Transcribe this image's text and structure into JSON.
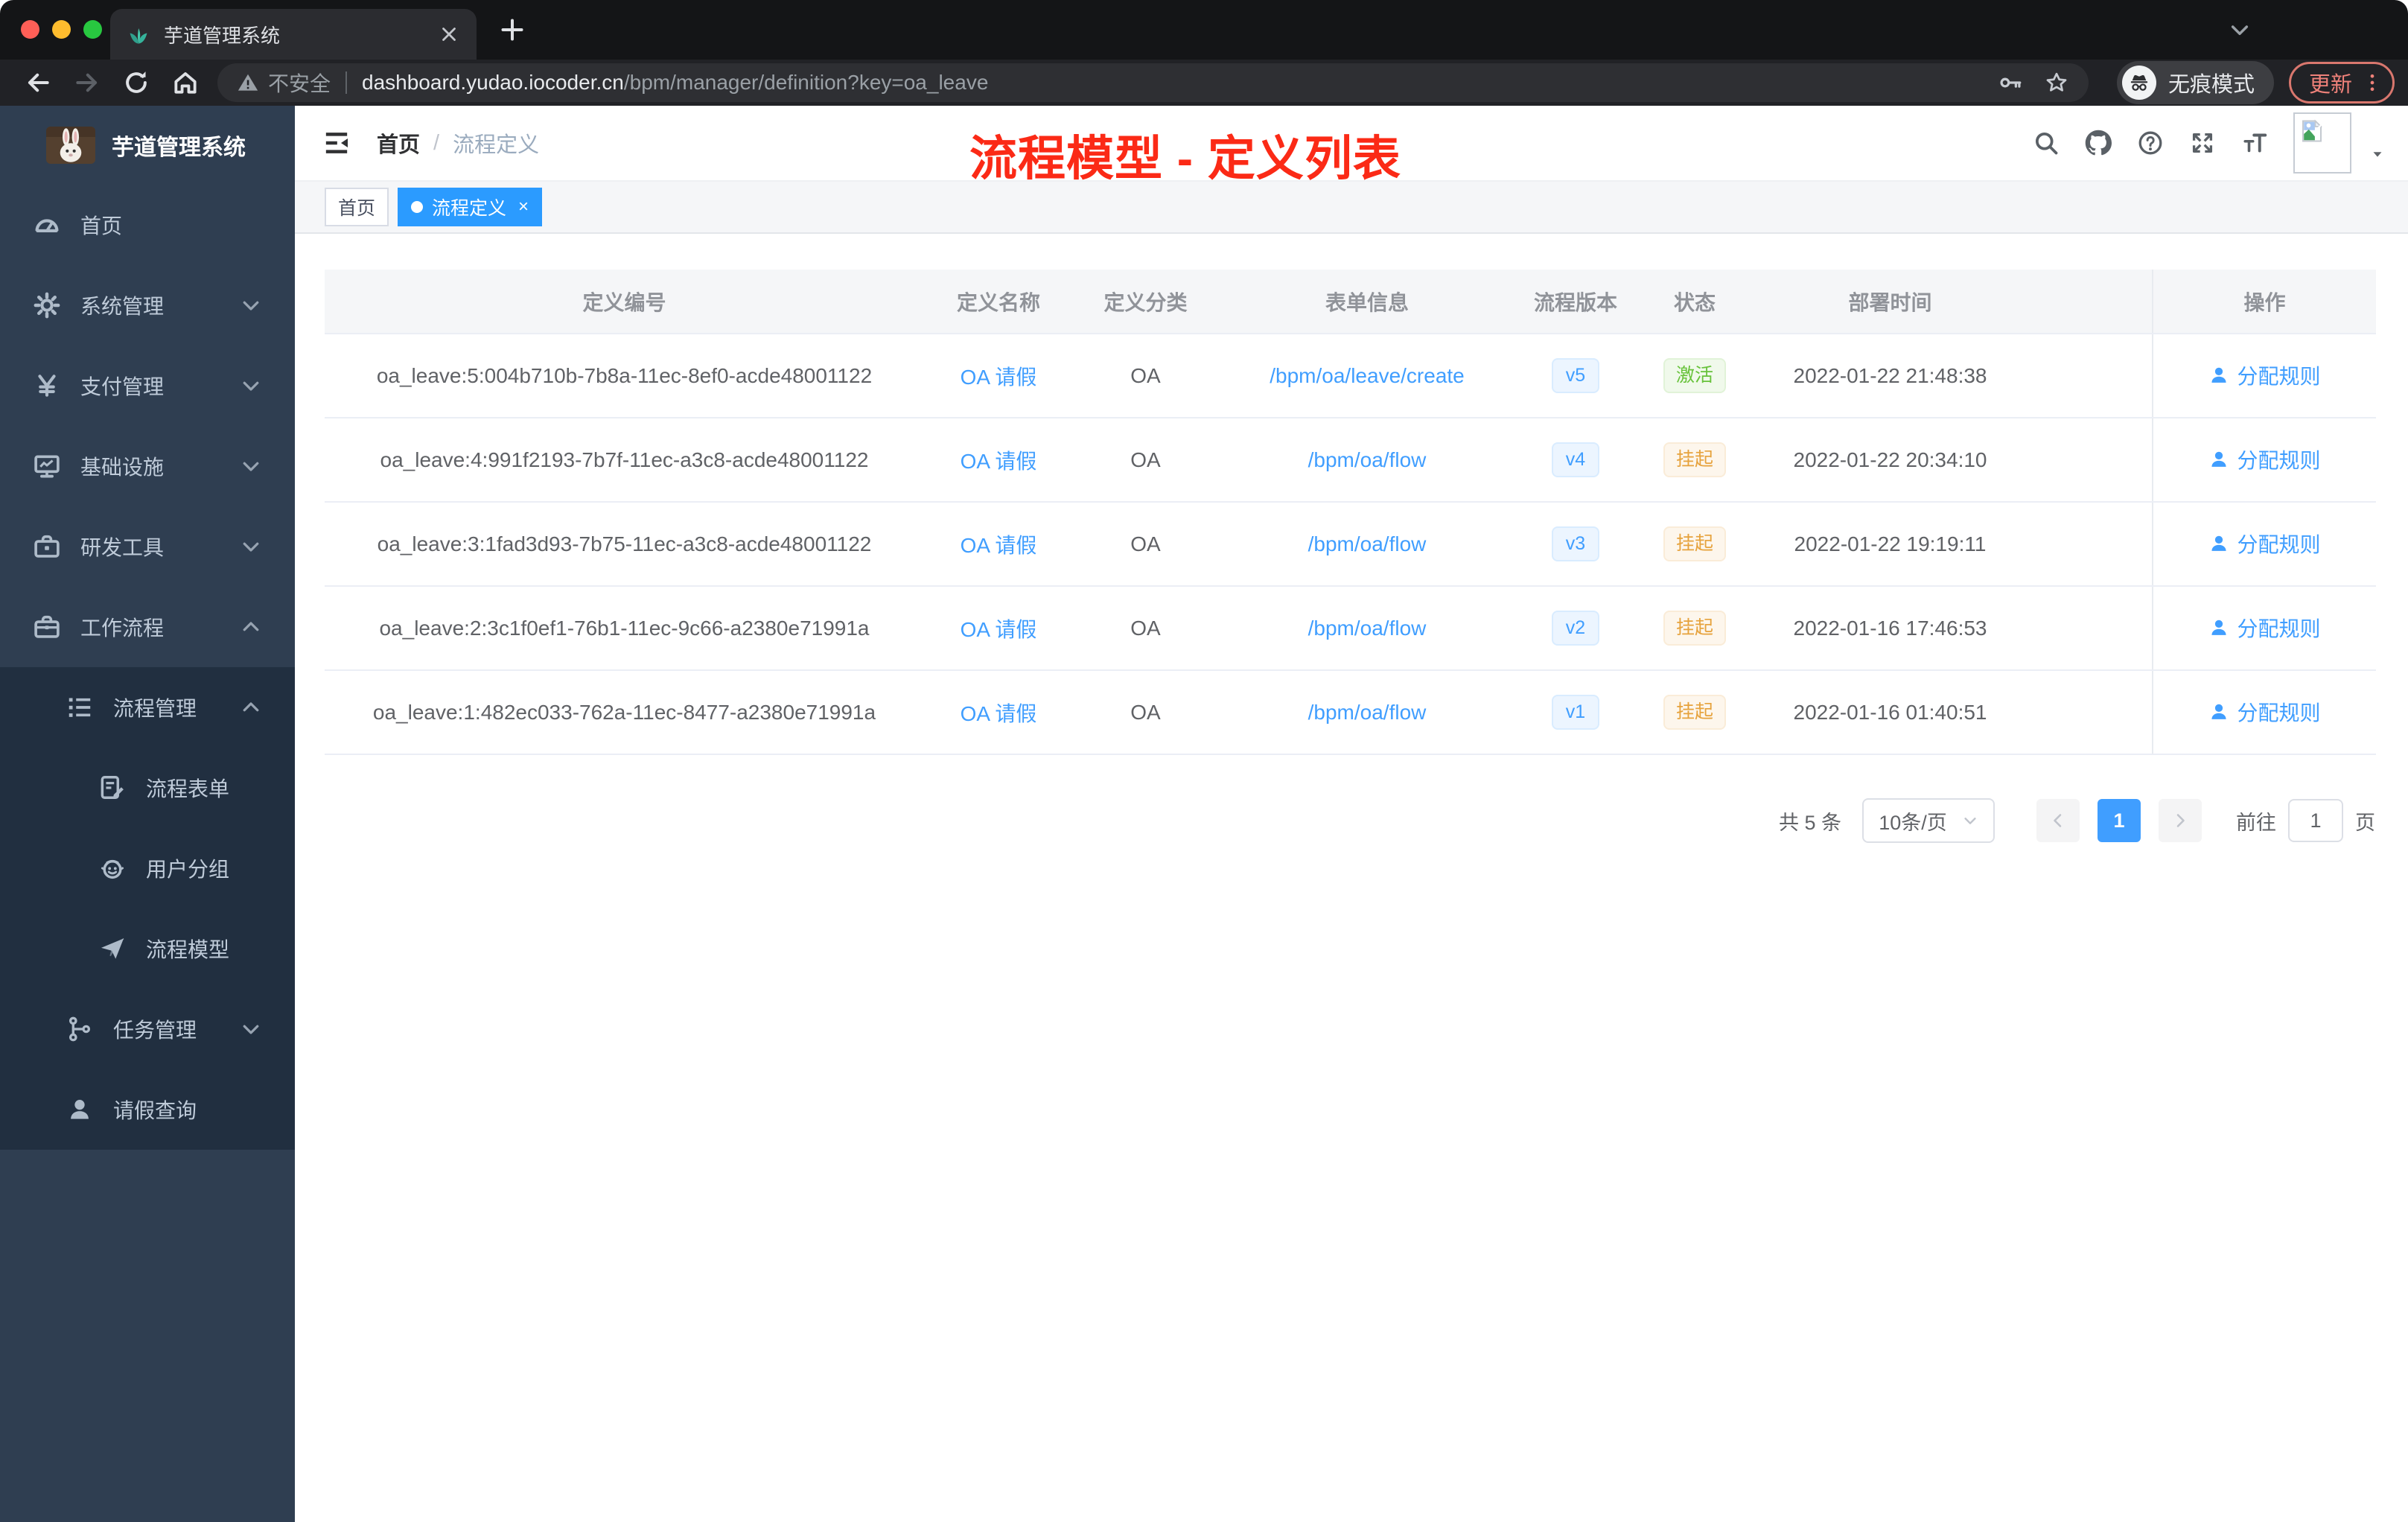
{
  "colors": {
    "accent": "#409eff",
    "annotation_red": "#fb2a16",
    "tag_active_blue": "#2b9bff",
    "version_badge_text": "#409eff",
    "version_badge_bg": "#ecf5ff",
    "status_active_text": "#67c23a",
    "status_active_bg": "#f0f9eb",
    "status_suspend_text": "#e6a23c",
    "status_suspend_bg": "#fdf6ec",
    "sidebar_bg": "#2f3e51",
    "sidebar_submenu_bg": "#212f40"
  },
  "browser": {
    "tab_title": "芋道管理系统",
    "close_glyph": "×",
    "security_warning": "不安全",
    "url_host": "dashboard.yudao.iocoder.cn",
    "url_path": "/bpm/manager/definition?key=oa_leave",
    "incognito_label": "无痕模式",
    "update_label": "更新"
  },
  "sidebar": {
    "title": "芋道管理系统",
    "items": [
      {
        "label": "首页",
        "icon": "dashboard-icon",
        "level": 0
      },
      {
        "label": "系统管理",
        "icon": "gear-icon",
        "level": 0,
        "arrow": "down"
      },
      {
        "label": "支付管理",
        "icon": "yen-icon",
        "level": 0,
        "arrow": "down"
      },
      {
        "label": "基础设施",
        "icon": "monitor-icon",
        "level": 0,
        "arrow": "down"
      },
      {
        "label": "研发工具",
        "icon": "toolbox-icon",
        "level": 0,
        "arrow": "down"
      },
      {
        "label": "工作流程",
        "icon": "briefcase-icon",
        "level": 0,
        "arrow": "up"
      },
      {
        "label": "流程管理",
        "icon": "list-tree-icon",
        "level": 1,
        "arrow": "up",
        "dark": true
      },
      {
        "label": "流程表单",
        "icon": "doc-edit-icon",
        "level": 2,
        "dark": true
      },
      {
        "label": "用户分组",
        "icon": "robot-icon",
        "level": 2,
        "dark": true
      },
      {
        "label": "流程模型",
        "icon": "paper-plane-icon",
        "level": 2,
        "dark": true
      },
      {
        "label": "任务管理",
        "icon": "org-tree-icon",
        "level": 1,
        "arrow": "down",
        "dark": true
      },
      {
        "label": "请假查询",
        "icon": "user-icon",
        "level": 1,
        "dark": true
      }
    ]
  },
  "header": {
    "breadcrumb": {
      "root": "首页",
      "separator": "/",
      "current": "流程定义"
    },
    "annotation": "流程模型 - 定义列表"
  },
  "tags": [
    {
      "label": "首页",
      "active": false
    },
    {
      "label": "流程定义",
      "active": true,
      "close_glyph": "×"
    }
  ],
  "table": {
    "columns": [
      "定义编号",
      "定义名称",
      "定义分类",
      "表单信息",
      "流程版本",
      "状态",
      "部署时间",
      "操作"
    ],
    "action_label": "分配规则",
    "rows": [
      {
        "id": "oa_leave:5:004b710b-7b8a-11ec-8ef0-acde48001122",
        "name": "OA 请假",
        "category": "OA",
        "form": "/bpm/oa/leave/create",
        "version": "v5",
        "status": "激活",
        "status_type": "success",
        "deployed": "2022-01-22 21:48:38"
      },
      {
        "id": "oa_leave:4:991f2193-7b7f-11ec-a3c8-acde48001122",
        "name": "OA 请假",
        "category": "OA",
        "form": "/bpm/oa/flow",
        "version": "v4",
        "status": "挂起",
        "status_type": "warning",
        "deployed": "2022-01-22 20:34:10"
      },
      {
        "id": "oa_leave:3:1fad3d93-7b75-11ec-a3c8-acde48001122",
        "name": "OA 请假",
        "category": "OA",
        "form": "/bpm/oa/flow",
        "version": "v3",
        "status": "挂起",
        "status_type": "warning",
        "deployed": "2022-01-22 19:19:11"
      },
      {
        "id": "oa_leave:2:3c1f0ef1-76b1-11ec-9c66-a2380e71991a",
        "name": "OA 请假",
        "category": "OA",
        "form": "/bpm/oa/flow",
        "version": "v2",
        "status": "挂起",
        "status_type": "warning",
        "deployed": "2022-01-16 17:46:53"
      },
      {
        "id": "oa_leave:1:482ec033-762a-11ec-8477-a2380e71991a",
        "name": "OA 请假",
        "category": "OA",
        "form": "/bpm/oa/flow",
        "version": "v1",
        "status": "挂起",
        "status_type": "warning",
        "deployed": "2022-01-16 01:40:51"
      }
    ]
  },
  "pagination": {
    "total": "共 5 条",
    "page_size": "10条/页",
    "current_page": "1",
    "goto_label": "前往",
    "goto_value": "1",
    "page_unit": "页"
  }
}
